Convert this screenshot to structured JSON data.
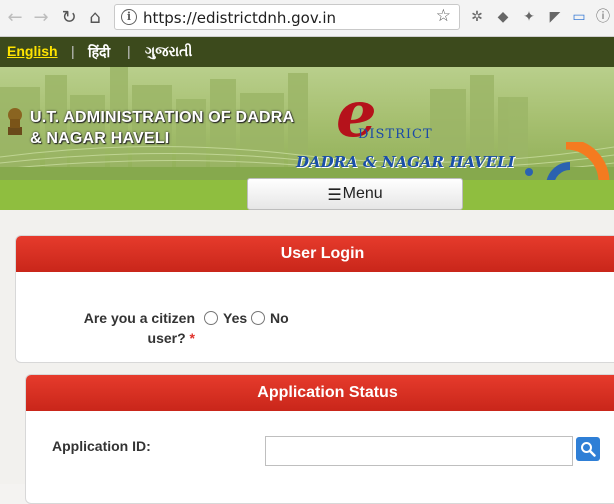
{
  "browser": {
    "url": "https://edistrictdnh.gov.in",
    "back_icon": "arrow-left-icon",
    "forward_icon": "arrow-right-icon",
    "reload_icon": "reload-icon",
    "home_icon": "home-icon"
  },
  "languages": [
    {
      "label": "English",
      "active": true
    },
    {
      "label": "हिंदी",
      "active": false
    },
    {
      "label": "ગુજરાતી",
      "active": false
    }
  ],
  "banner": {
    "admin_line1": "U.T. ADMINISTRATION OF DADRA",
    "admin_line2": "& NAGAR HAVELI",
    "e_letter": "e",
    "district_text": "DISTRICT",
    "dnh_text": "DADRA & NAGAR HAVELI"
  },
  "menu": {
    "label": "Menu"
  },
  "login_panel": {
    "title": "User Login",
    "question_line1": "Are you a citizen",
    "question_line2": "user?",
    "required_mark": "*",
    "yes_label": "Yes",
    "no_label": "No"
  },
  "status_panel": {
    "title": "Application Status",
    "field_label": "Application ID:",
    "input_value": "",
    "input_placeholder": ""
  },
  "colors": {
    "panel_header": "#d9301f",
    "menu_strip": "#8fbe3f",
    "lang_bar": "#3c4a1c",
    "active_language": "#ffe400"
  }
}
